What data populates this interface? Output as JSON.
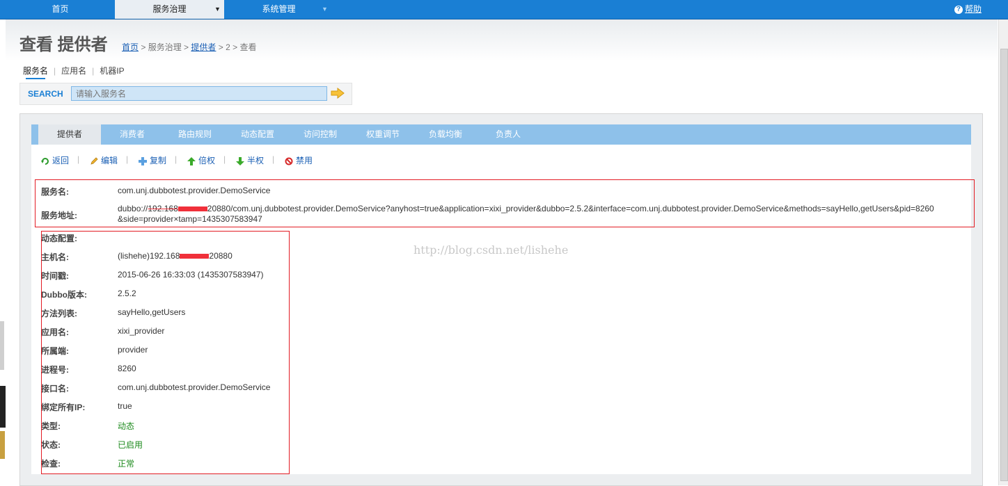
{
  "nav": {
    "home": "首页",
    "service_governance": "服务治理",
    "system_management": "系统管理",
    "help": "帮助",
    "caret": "▼",
    "caret2": "▼"
  },
  "page": {
    "title": "查看 提供者",
    "breadcrumb": {
      "home": "首页",
      "sep1": " > ",
      "governance": "服务治理",
      "sep2": " > ",
      "providers": "提供者",
      "sep3": " > ",
      "id": "2",
      "sep4": " > ",
      "current": "查看"
    }
  },
  "search": {
    "tabs": [
      "服务名",
      "应用名",
      "机器IP"
    ],
    "label": "SEARCH",
    "placeholder": "请输入服务名"
  },
  "tabs": [
    "提供者",
    "消费者",
    "路由规则",
    "动态配置",
    "访问控制",
    "权重调节",
    "负载均衡",
    "负责人"
  ],
  "actions": {
    "back": "返回",
    "edit": "编辑",
    "copy": "复制",
    "double": "倍权",
    "half": "半权",
    "disable": "禁用",
    "sep": "|"
  },
  "details": {
    "service_label": "服务名:",
    "service_value": "com.unj.dubbotest.provider.DemoService",
    "address_label": "服务地址:",
    "address_prefix": "dubbo://",
    "address_ip_fragment": "192.168",
    "address_rest": "20880/com.unj.dubbotest.provider.DemoService?anyhost=true&application=xixi_provider&dubbo=2.5.2&interface=com.unj.dubbotest.provider.DemoService&methods=sayHello,getUsers&pid=8260",
    "address_line2": "&side=provider×tamp=1435307583947",
    "rows": [
      {
        "label": "动态配置:",
        "value": ""
      },
      {
        "label": "主机名:",
        "value": "(lishehe)192.168",
        "value_suffix": "20880"
      },
      {
        "label": "时间戳:",
        "value": "2015-06-26 16:33:03 (1435307583947)"
      },
      {
        "label": "Dubbo版本:",
        "value": "2.5.2"
      },
      {
        "label": "方法列表:",
        "value": "sayHello,getUsers"
      },
      {
        "label": "应用名:",
        "value": "xixi_provider"
      },
      {
        "label": "所属端:",
        "value": "provider"
      },
      {
        "label": "进程号:",
        "value": "8260"
      },
      {
        "label": "接口名:",
        "value": "com.unj.dubbotest.provider.DemoService"
      },
      {
        "label": "绑定所有IP:",
        "value": "true"
      },
      {
        "label": "类型:",
        "value": "动态"
      },
      {
        "label": "状态:",
        "value": "已启用"
      },
      {
        "label": "检查:",
        "value": "正常"
      }
    ]
  },
  "watermark": "http://blog.csdn.net/lishehe",
  "colors": {
    "nav_blue": "#1a7fd4",
    "tab_blue": "#8ec1ea",
    "highlight_red": "#e31b23",
    "status_green": "#1c8a1c"
  }
}
